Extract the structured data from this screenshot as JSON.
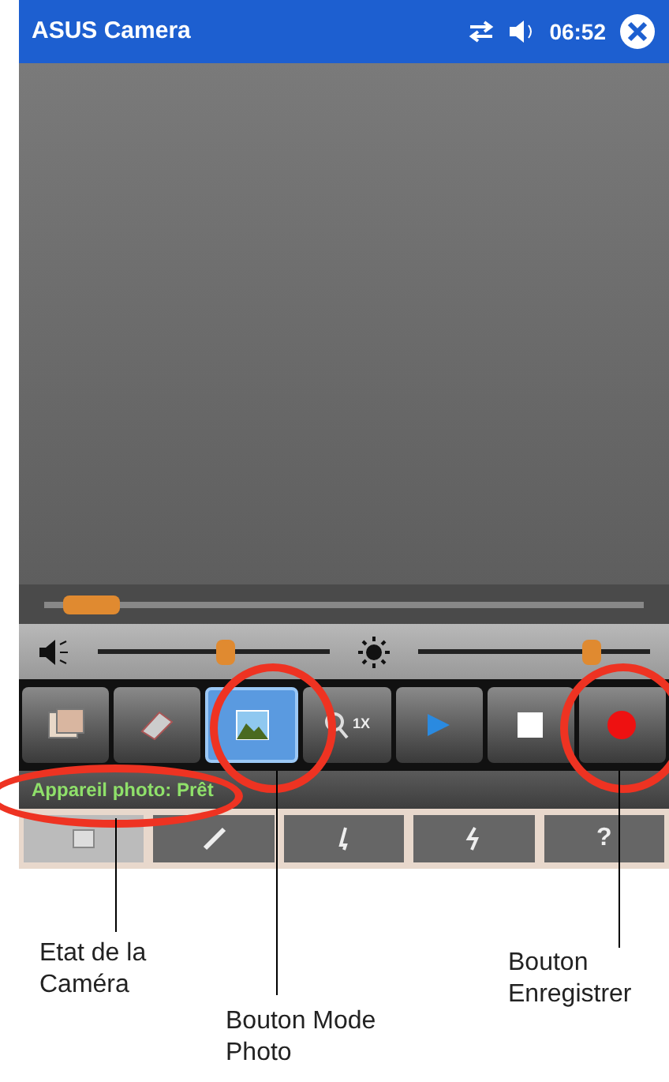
{
  "window": {
    "title": "ASUS Camera",
    "time": "06:52"
  },
  "seek": {
    "level": 0.08
  },
  "volume": {
    "level": 0.55
  },
  "brightness": {
    "level": 0.75
  },
  "toolbar": [
    {
      "kind": "gallery",
      "selected": false
    },
    {
      "kind": "settings",
      "selected": false
    },
    {
      "kind": "photo",
      "selected": true
    },
    {
      "kind": "zoom",
      "selected": false,
      "label": "1X"
    },
    {
      "kind": "play",
      "selected": false
    },
    {
      "kind": "stop",
      "selected": false
    },
    {
      "kind": "record",
      "selected": false
    }
  ],
  "status": {
    "text": "Appareil photo: Prêt"
  },
  "tabs": [
    {
      "kind": "screen",
      "selected": true
    },
    {
      "kind": "wand",
      "selected": false
    },
    {
      "kind": "light",
      "selected": false
    },
    {
      "kind": "flash",
      "selected": false
    },
    {
      "kind": "help",
      "selected": false,
      "label": "?"
    }
  ],
  "annotations": [
    {
      "text": "Etat de la Caméra"
    },
    {
      "text": "Bouton Mode Photo"
    },
    {
      "text": "Bouton Enregistrer"
    }
  ]
}
